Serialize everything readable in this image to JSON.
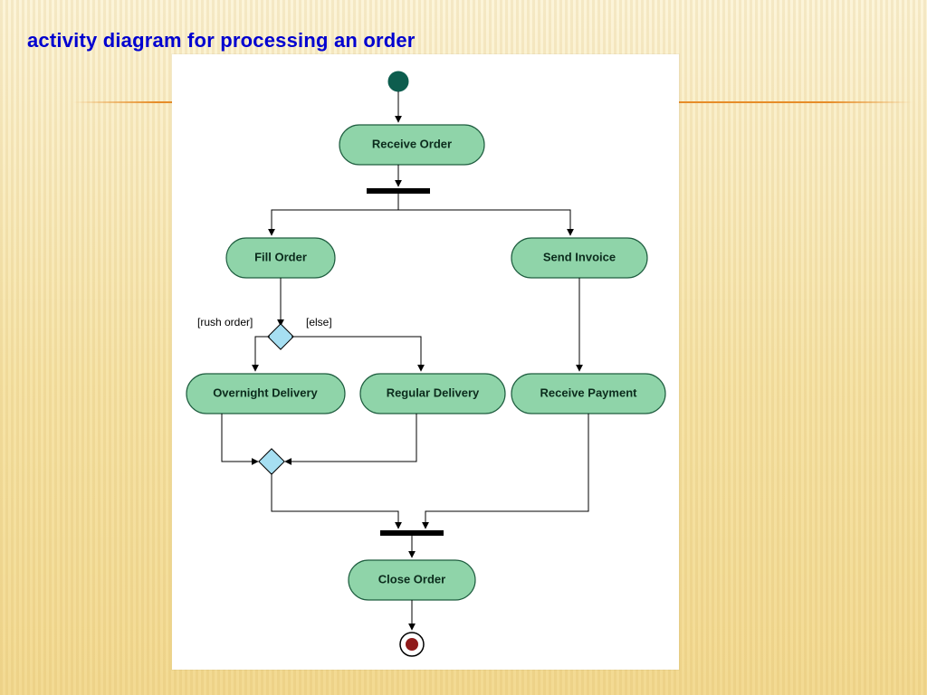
{
  "title": "activity diagram for processing an order",
  "diagram": {
    "type": "uml-activity",
    "start": true,
    "end": true,
    "activities": {
      "receive_order": {
        "label": "Receive Order"
      },
      "fill_order": {
        "label": "Fill Order"
      },
      "send_invoice": {
        "label": "Send Invoice"
      },
      "overnight": {
        "label": "Overnight Delivery"
      },
      "regular": {
        "label": "Regular Delivery"
      },
      "receive_payment": {
        "label": "Receive Payment"
      },
      "close_order": {
        "label": "Close Order"
      }
    },
    "guards": {
      "rush": "[rush order]",
      "else": "[else]"
    },
    "forks": [
      "after_receive_order"
    ],
    "joins": [
      "before_close_order"
    ],
    "decisions": [
      "delivery_type"
    ],
    "merges": [
      "delivery_merge"
    ],
    "edges": [
      [
        "start",
        "receive_order"
      ],
      [
        "receive_order",
        "fork:after_receive_order"
      ],
      [
        "fork:after_receive_order",
        "fill_order"
      ],
      [
        "fork:after_receive_order",
        "send_invoice"
      ],
      [
        "fill_order",
        "decision:delivery_type"
      ],
      [
        "decision:delivery_type",
        "overnight",
        "rush"
      ],
      [
        "decision:delivery_type",
        "regular",
        "else"
      ],
      [
        "overnight",
        "merge:delivery_merge"
      ],
      [
        "regular",
        "merge:delivery_merge"
      ],
      [
        "send_invoice",
        "receive_payment"
      ],
      [
        "merge:delivery_merge",
        "join:before_close_order"
      ],
      [
        "receive_payment",
        "join:before_close_order"
      ],
      [
        "join:before_close_order",
        "close_order"
      ],
      [
        "close_order",
        "end"
      ]
    ]
  }
}
